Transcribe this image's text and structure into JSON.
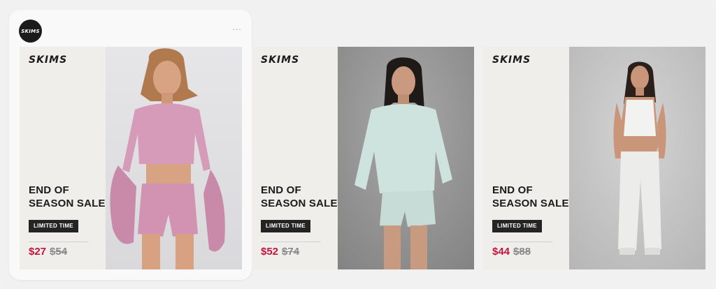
{
  "account": {
    "avatar_text": "SKIMS",
    "more_label": "···"
  },
  "colors": {
    "sale_price": "#c2143b",
    "badge_bg": "#242424",
    "panel_bg": "#efeeeb"
  },
  "ads": [
    {
      "brand": "SKIMS",
      "headline_line1": "END OF",
      "headline_line2": "SEASON SALE",
      "badge": "LIMITED TIME",
      "sale_price": "$27",
      "original_price": "$54",
      "photo": "model in pink waffle henley crop top and shorts"
    },
    {
      "brand": "SKIMS",
      "headline_line1": "END OF",
      "headline_line2": "SEASON SALE",
      "badge": "LIMITED TIME",
      "sale_price": "$52",
      "original_price": "$74",
      "photo": "model in mint long sleeve tee and shorts"
    },
    {
      "brand": "SKIMS",
      "headline_line1": "END OF",
      "headline_line2": "SEASON SALE",
      "badge": "LIMITED TIME",
      "sale_price": "$44",
      "original_price": "$88",
      "photo": "model in white pointelle cami and pants"
    }
  ]
}
